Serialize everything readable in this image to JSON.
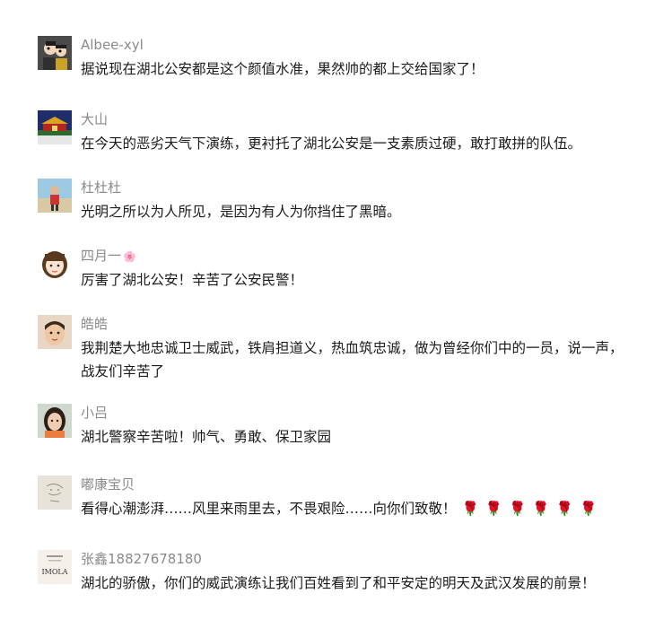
{
  "comments": [
    {
      "name": "Albee-xyl",
      "text": "据说现在湖北公安都是这个颜值水准，果然帅的都上交给国家了！",
      "avatar_icon": "cartoon-couple-avatar"
    },
    {
      "name": "大山",
      "text": "在今天的恶劣天气下演练，更衬托了湖北公安是一支素质过硬，敢打敢拼的队伍。",
      "avatar_icon": "tiananmen-avatar"
    },
    {
      "name": "杜杜杜",
      "text": "光明之所以为人所见，是因为有人为你挡住了黑暗。",
      "avatar_icon": "beach-photo-avatar"
    },
    {
      "name": "四月一",
      "name_emoji": "🌸",
      "text": "厉害了湖北公安！辛苦了公安民警！",
      "avatar_icon": "cartoon-girl-avatar"
    },
    {
      "name": "皓皓",
      "text": "我荆楚大地忠诚卫士威武，铁肩担道义，热血筑忠诚，做为曾经你们中的一员，说一声，战友们辛苦了",
      "avatar_icon": "child-portrait-avatar"
    },
    {
      "name": "小吕",
      "text": "湖北警察辛苦啦！帅气、勇敢、保卫家园",
      "avatar_icon": "woman-portrait-avatar"
    },
    {
      "name": "嘟康宝贝",
      "text": "看得心潮澎湃……风里来雨里去，不畏艰险……向你们致敬！",
      "text_suffix": "🌹🌹🌹🌹🌹🌹",
      "avatar_icon": "sketch-avatar"
    },
    {
      "name": "张鑫18827678180",
      "text": "湖北的骄傲，你们的威武演练让我们百姓看到了和平安定的明天及武汉发展的前景！",
      "avatar_icon": "imola-logo-avatar",
      "avatar_text": "IMOLA"
    }
  ]
}
